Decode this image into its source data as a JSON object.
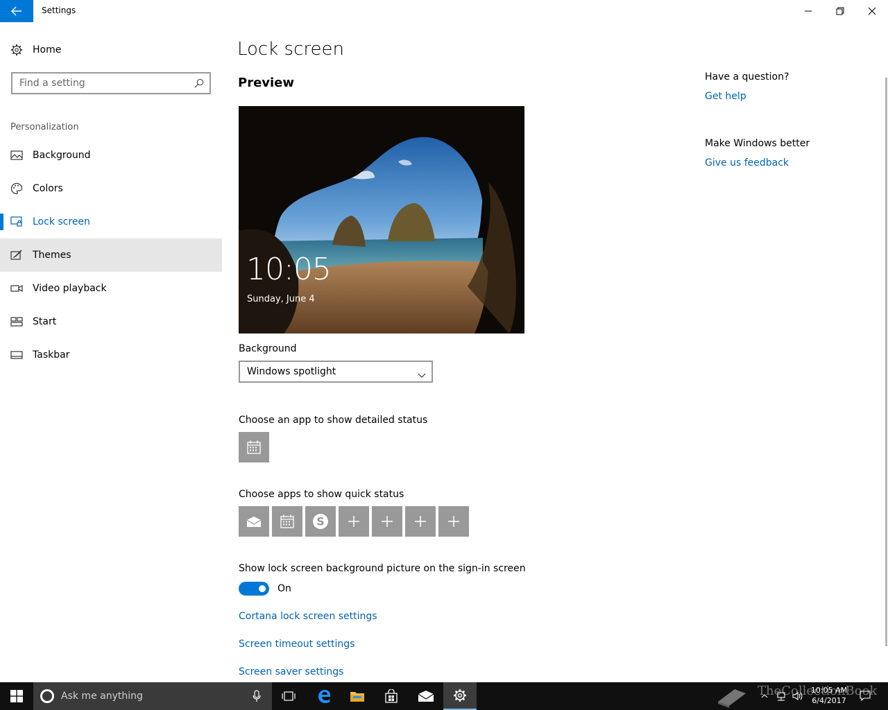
{
  "titlebar": {
    "app_title": "Settings"
  },
  "nav": {
    "home_label": "Home",
    "search_placeholder": "Find a setting",
    "section_label": "Personalization",
    "items": [
      {
        "label": "Background",
        "icon": "picture-icon"
      },
      {
        "label": "Colors",
        "icon": "palette-icon"
      },
      {
        "label": "Lock screen",
        "icon": "lock-screen-icon",
        "selected": true
      },
      {
        "label": "Themes",
        "icon": "themes-icon",
        "hover": true
      },
      {
        "label": "Video playback",
        "icon": "video-icon"
      },
      {
        "label": "Start",
        "icon": "start-icon"
      },
      {
        "label": "Taskbar",
        "icon": "taskbar-icon"
      }
    ]
  },
  "main": {
    "page_title": "Lock screen",
    "preview_title": "Preview",
    "preview_time": "10:05",
    "preview_date": "Sunday, June 4",
    "background_label": "Background",
    "background_value": "Windows spotlight",
    "detailed_status_label": "Choose an app to show detailed status",
    "quick_status_label": "Choose apps to show quick status",
    "quick_status_apps": [
      "mail-icon",
      "calendar-icon",
      "skype-icon",
      "plus-icon",
      "plus-icon",
      "plus-icon",
      "plus-icon"
    ],
    "signin_label": "Show lock screen background picture on the sign-in screen",
    "signin_state": "On",
    "links": {
      "cortana": "Cortana lock screen settings",
      "timeout": "Screen timeout settings",
      "saver": "Screen saver settings"
    }
  },
  "right": {
    "question_head": "Have a question?",
    "get_help": "Get help",
    "feedback_head": "Make Windows better",
    "give_feedback": "Give us feedback"
  },
  "taskbar": {
    "search_text": "Ask me anything",
    "clock_time": "10:05 AM",
    "clock_date": "6/4/2017",
    "watermark": "TheCollectionBook"
  },
  "colors": {
    "accent": "#0078d7",
    "link": "#0063b1",
    "hover": "#e6e6e6",
    "tile": "#999999",
    "taskbar": "#101010"
  }
}
